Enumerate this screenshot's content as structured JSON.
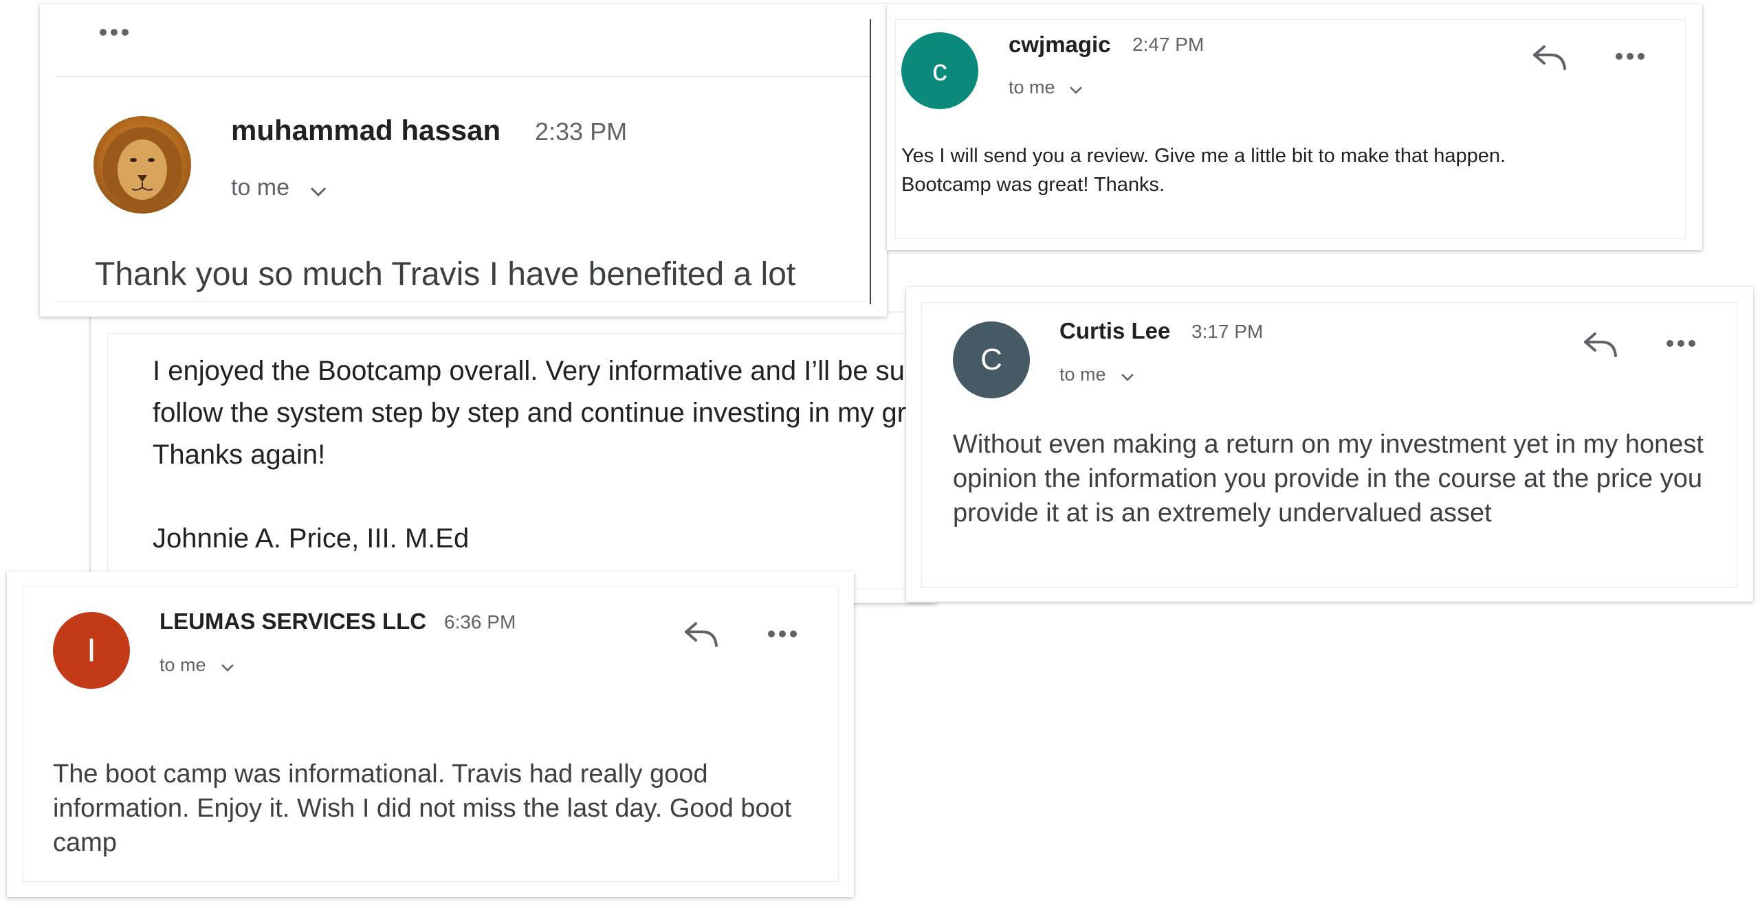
{
  "emails": {
    "hassan": {
      "name": "muhammad hassan",
      "time": "2:33 PM",
      "recipient": "to me",
      "body": "Thank you so much Travis I have benefited a lot",
      "avatar_icon": "lion-avatar-icon"
    },
    "cwj": {
      "name": "cwjmagic",
      "time": "2:47 PM",
      "recipient": "to me",
      "avatar_letter": "c",
      "avatar_color": "#0b8a7c",
      "body_line1": "Yes I will send you a review. Give me a little bit to make that happen.",
      "body_line2": "Bootcamp was great! Thanks."
    },
    "price": {
      "body": "I enjoyed the Bootcamp overall. Very informative and I’ll be sure to follow the system step by step and continue investing in my growth. Thanks again!",
      "signature": "Johnnie A. Price, III. M.Ed"
    },
    "curtis": {
      "name": "Curtis Lee",
      "time": "3:17 PM",
      "recipient": "to me",
      "avatar_letter": "C",
      "avatar_color": "#455a64",
      "body": "Without even making a return on my investment yet in my honest opinion the information you provide in the course at the price you provide it at is an extremely undervalued asset"
    },
    "leumas": {
      "name": "LEUMAS SERVICES LLC",
      "time": "6:36 PM",
      "recipient": "to me",
      "avatar_letter": "I",
      "avatar_color": "#c23a17",
      "body": "The boot camp was informational. Travis had really good information. Enjoy it. Wish I did not miss the last day. Good boot camp"
    }
  },
  "icons": {
    "reply": "reply-icon",
    "more": "more-options-icon",
    "expand": "chevron-down-icon"
  }
}
